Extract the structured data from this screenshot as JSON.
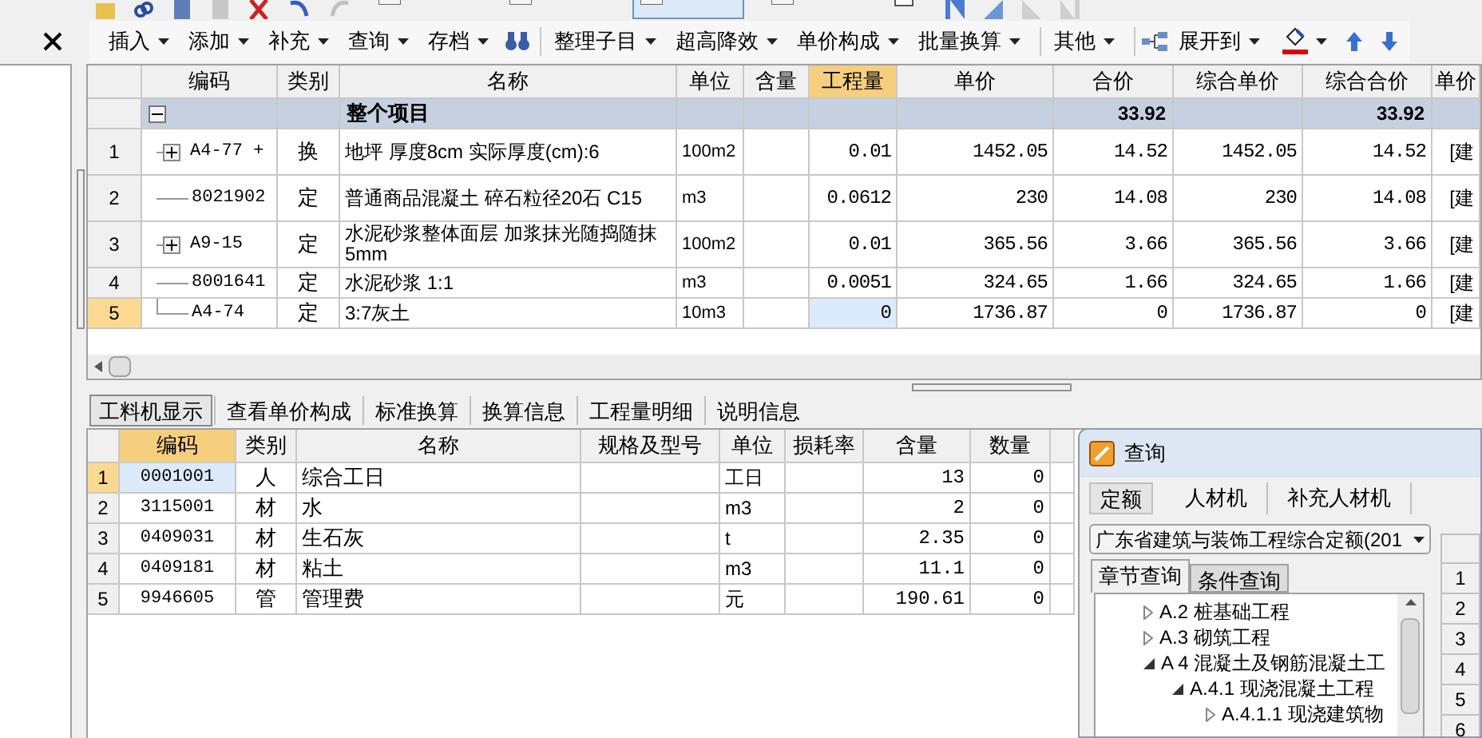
{
  "top_toolbar": [
    {
      "kind": "button",
      "selected": false
    },
    {
      "kind": "button",
      "selected": false
    },
    {
      "kind": "button",
      "selected": true
    },
    {
      "kind": "button",
      "selected": false
    },
    {
      "kind": "checkbox",
      "checked": false
    }
  ],
  "toolbar": {
    "groups": [
      [
        "插入",
        "添加",
        "补充",
        "查询",
        "存档"
      ],
      [
        "整理子目",
        "超高降效",
        "单价构成",
        "批量换算"
      ],
      [
        "其他"
      ],
      [
        "展开到"
      ]
    ]
  },
  "item_table": {
    "columns": [
      {
        "label": "编码",
        "selected": false
      },
      {
        "label": "类别",
        "selected": false
      },
      {
        "label": "名称",
        "selected": false
      },
      {
        "label": "单位",
        "selected": false
      },
      {
        "label": "含量",
        "selected": false
      },
      {
        "label": "工程量",
        "selected": true
      },
      {
        "label": "单价",
        "selected": false
      },
      {
        "label": "合价",
        "selected": false
      },
      {
        "label": "综合单价",
        "selected": false
      },
      {
        "label": "综合合价",
        "selected": false
      },
      {
        "label": "单价",
        "selected": false
      }
    ],
    "summary_row": {
      "label": "整个项目",
      "expanded": true,
      "total": "33.92",
      "comp_total": "33.92"
    },
    "rows": [
      {
        "num": "1",
        "kind": "expandable",
        "code": "A4-77 +",
        "type": "换",
        "name": "地坪 厚度8cm 实际厚度(cm):6",
        "unit": "100m2",
        "qty": "0.01",
        "price": "1452.05",
        "total": "14.52",
        "comp_price": "1452.05",
        "comp_total": "14.52",
        "column_12": "[建",
        "selected": false
      },
      {
        "num": "2",
        "kind": "leaf",
        "code": "8021902",
        "type": "定",
        "name": "普通商品混凝土 碎石粒径20石 C15",
        "unit": "m3",
        "qty": "0.0612",
        "price": "230",
        "total": "14.08",
        "comp_price": "230",
        "comp_total": "14.08",
        "column_12": "[建",
        "selected": false
      },
      {
        "num": "3",
        "kind": "expandable",
        "code": "A9-15",
        "type": "定",
        "name": "水泥砂浆整体面层 加浆抹光随捣随抹5mm",
        "unit": "100m2",
        "qty": "0.01",
        "price": "365.56",
        "total": "3.66",
        "comp_price": "365.56",
        "comp_total": "3.66",
        "column_12": "[建",
        "selected": false
      },
      {
        "num": "4",
        "kind": "leaf",
        "code": "8001641",
        "type": "定",
        "name": "水泥砂浆 1:1",
        "unit": "m3",
        "qty": "0.0051",
        "price": "324.65",
        "total": "1.66",
        "comp_price": "324.65",
        "comp_total": "1.66",
        "column_12": "[建",
        "selected": false
      },
      {
        "num": "5",
        "kind": "last",
        "code": "A4-74",
        "type": "定",
        "name": "3:7灰土",
        "unit": "10m3",
        "qty": "0",
        "price": "1736.87",
        "total": "0",
        "comp_price": "1736.87",
        "comp_total": "0",
        "column_12": "[建",
        "selected": true
      }
    ]
  },
  "detail_tabs": [
    {
      "label": "工料机显示",
      "selected": true
    },
    {
      "label": "查看单价构成",
      "selected": false
    },
    {
      "label": "标准换算",
      "selected": false
    },
    {
      "label": "换算信息",
      "selected": false
    },
    {
      "label": "工程量明细",
      "selected": false
    },
    {
      "label": "说明信息",
      "selected": false
    }
  ],
  "resource_table": {
    "columns": [
      {
        "label": "编码",
        "selected": true
      },
      {
        "label": "类别",
        "selected": false
      },
      {
        "label": "名称",
        "selected": false
      },
      {
        "label": "规格及型号",
        "selected": false
      },
      {
        "label": "单位",
        "selected": false
      },
      {
        "label": "损耗率",
        "selected": false
      },
      {
        "label": "含量",
        "selected": false
      },
      {
        "label": "数量",
        "selected": false
      }
    ],
    "rows": [
      {
        "num": "1",
        "code": "0001001",
        "type": "人",
        "name": "综合工日",
        "unit": "工日",
        "amount": "13",
        "quantity": "0",
        "selected": true
      },
      {
        "num": "2",
        "code": "3115001",
        "type": "材",
        "name": "水",
        "unit": "m3",
        "amount": "2",
        "quantity": "0",
        "selected": false
      },
      {
        "num": "3",
        "code": "0409031",
        "type": "材",
        "name": "生石灰",
        "unit": "t",
        "amount": "2.35",
        "quantity": "0",
        "selected": false
      },
      {
        "num": "4",
        "code": "0409181",
        "type": "材",
        "name": "粘土",
        "unit": "m3",
        "amount": "11.1",
        "quantity": "0",
        "selected": false
      },
      {
        "num": "5",
        "code": "9946605",
        "type": "管",
        "name": "管理费",
        "unit": "元",
        "amount": "190.61",
        "quantity": "0",
        "selected": false
      }
    ]
  },
  "query_dialog": {
    "title": "查询",
    "tabs": [
      {
        "label": "定额",
        "selected": true
      },
      {
        "label": "人材机",
        "selected": false
      },
      {
        "label": "补充人材机",
        "selected": false
      }
    ],
    "library_select": "广东省建筑与装饰工程综合定额(201",
    "subtabs": [
      {
        "label": "章节查询",
        "selected": true
      },
      {
        "label": "条件查询",
        "selected": false
      }
    ],
    "tree": [
      {
        "label": "A.2 桩基础工程",
        "expanded": false
      },
      {
        "label": "A.3 砌筑工程",
        "expanded": false
      },
      {
        "label": "A 4 混凝土及钢筋混凝土工",
        "expanded": true,
        "children": [
          {
            "label": "A.4.1 现浇混凝土工程",
            "expanded": true,
            "children": [
              {
                "label": "A.4.1.1 现浇建筑物",
                "expanded": false
              }
            ]
          }
        ]
      }
    ],
    "side_rows": [
      "1",
      "2",
      "3",
      "4",
      "5",
      "6"
    ]
  }
}
